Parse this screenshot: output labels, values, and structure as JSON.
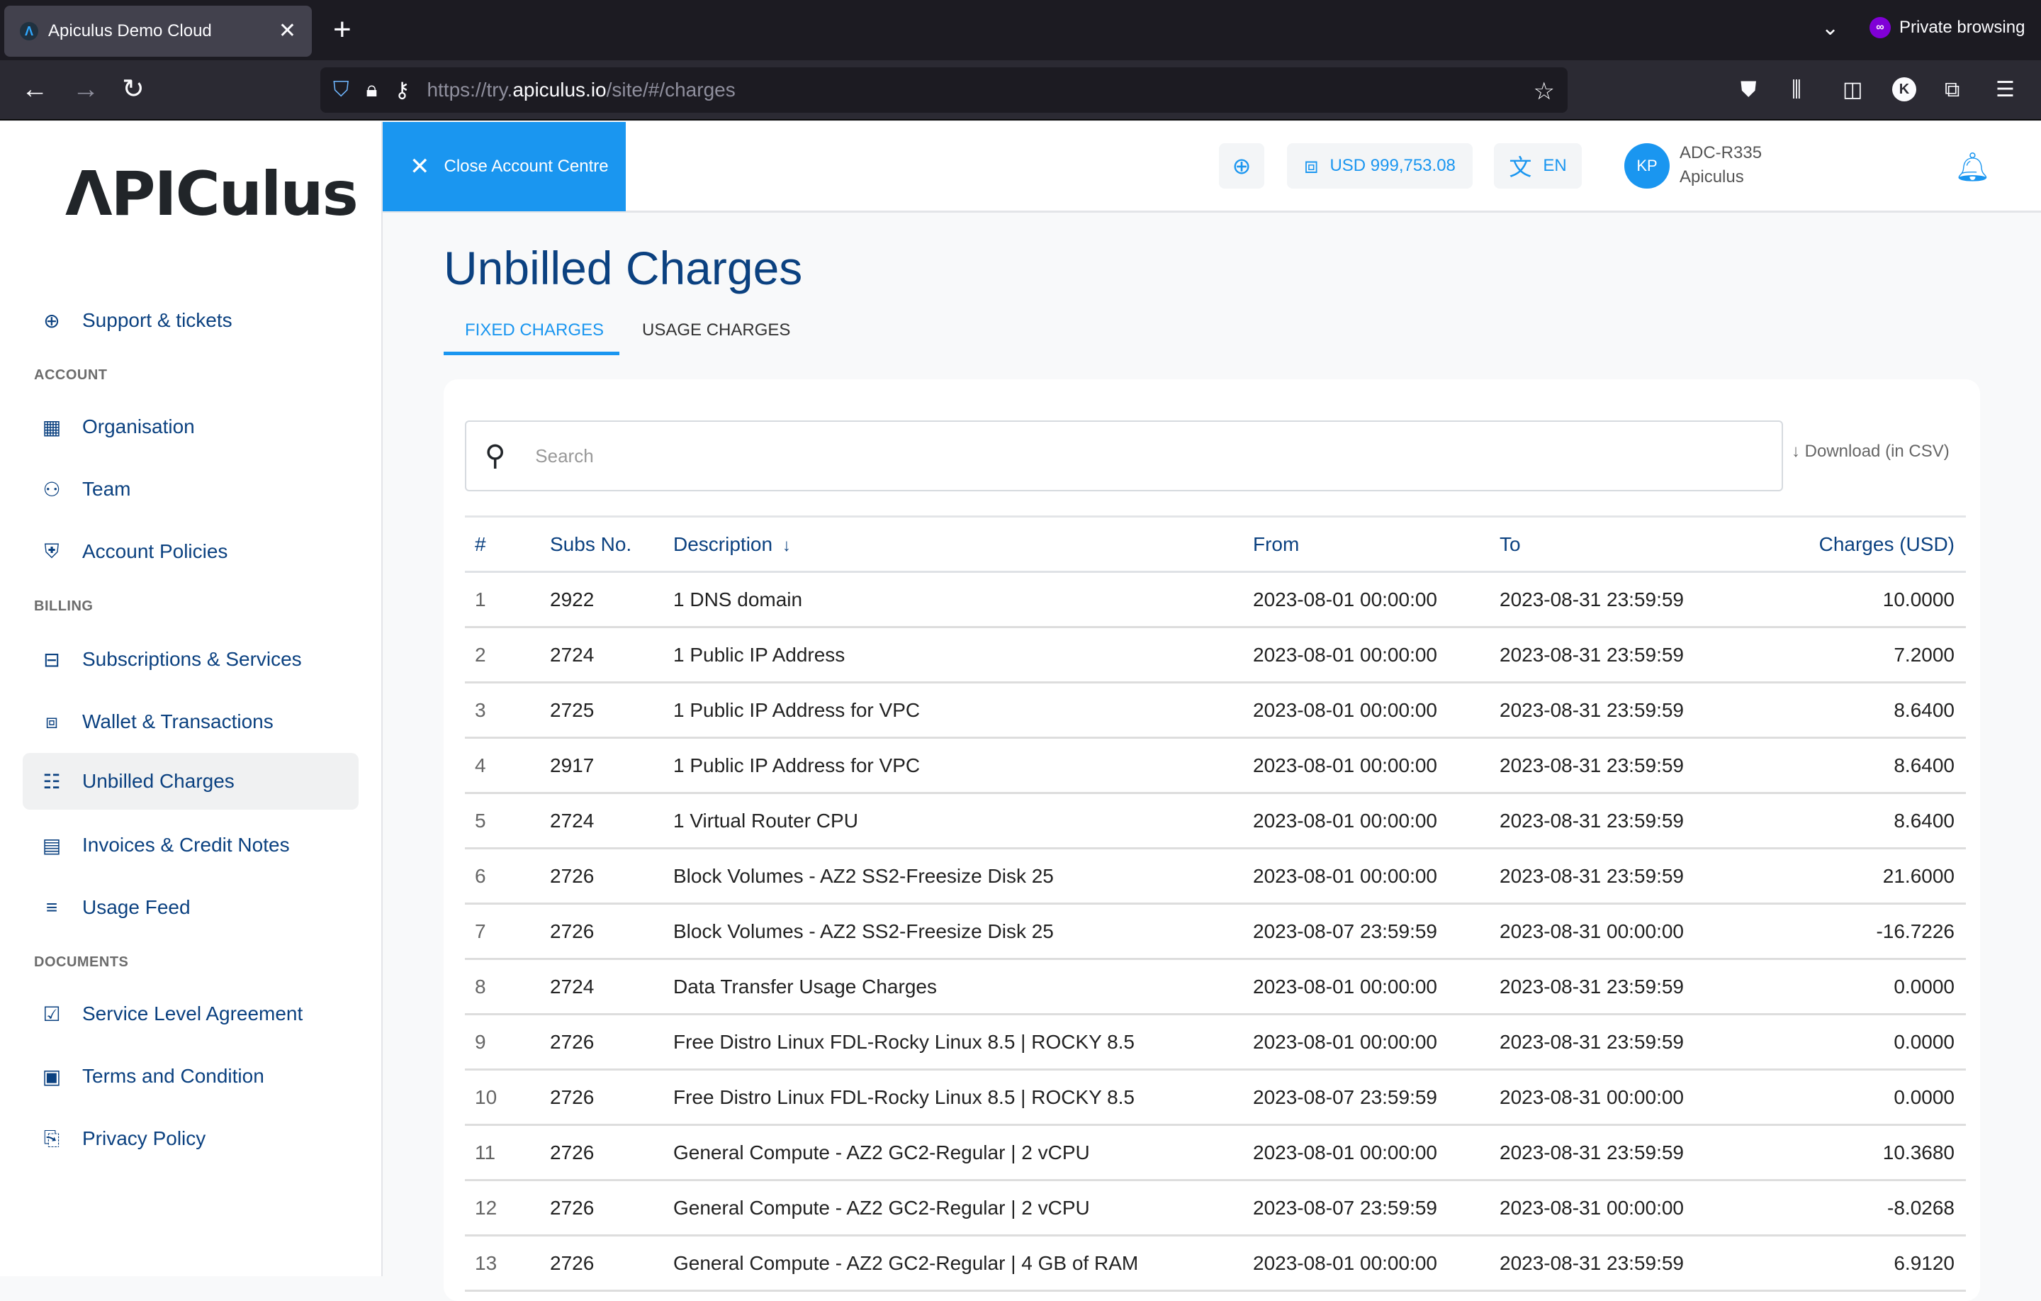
{
  "browser": {
    "tab_title": "Apiculus Demo Cloud",
    "tab_favicon": "Λ",
    "new_tab": "+",
    "private_label": "Private browsing",
    "url_prefix": "https://try.",
    "url_host": "apiculus.io",
    "url_path": "/site/#/charges",
    "profile_initial": "K"
  },
  "sidebar": {
    "logo": "ΛPICulus",
    "support": {
      "label": "Support & tickets",
      "icon": "lifebuoy-icon"
    },
    "sections": [
      {
        "label": "ACCOUNT",
        "items": [
          {
            "label": "Organisation",
            "icon": "building-icon"
          },
          {
            "label": "Team",
            "icon": "team-icon"
          },
          {
            "label": "Account Policies",
            "icon": "shield-star-icon"
          }
        ]
      },
      {
        "label": "BILLING",
        "items": [
          {
            "label": "Subscriptions & Services",
            "icon": "briefcase-icon"
          },
          {
            "label": "Wallet & Transactions",
            "icon": "wallet-icon"
          },
          {
            "label": "Unbilled Charges",
            "icon": "list-icon",
            "active": true
          },
          {
            "label": "Invoices & Credit Notes",
            "icon": "receipt-icon"
          },
          {
            "label": "Usage Feed",
            "icon": "lines-icon"
          }
        ]
      },
      {
        "label": "DOCUMENTS",
        "items": [
          {
            "label": "Service Level Agreement",
            "icon": "checklist-icon"
          },
          {
            "label": "Terms and Condition",
            "icon": "document-icon"
          },
          {
            "label": "Privacy Policy",
            "icon": "certificate-icon"
          }
        ]
      }
    ]
  },
  "header": {
    "close_label": "Close Account Centre",
    "wallet_balance": "USD 999,753.08",
    "language": "EN",
    "avatar_initials": "KP",
    "account_id": "ADC-R335",
    "account_org": "Apiculus"
  },
  "main": {
    "title": "Unbilled Charges",
    "tabs": [
      {
        "label": "FIXED CHARGES",
        "active": true
      },
      {
        "label": "USAGE CHARGES",
        "active": false
      }
    ],
    "search_placeholder": "Search",
    "search_value": "",
    "download_label": "Download (in CSV)",
    "table": {
      "columns": [
        "#",
        "Subs No.",
        "Description",
        "From",
        "To",
        "Charges (USD)"
      ],
      "sort_column": "Description",
      "sort_direction": "desc",
      "rows": [
        {
          "idx": "1",
          "sub": "2922",
          "desc": "1 DNS domain",
          "from": "2023-08-01 00:00:00",
          "to": "2023-08-31 23:59:59",
          "charge": "10.0000"
        },
        {
          "idx": "2",
          "sub": "2724",
          "desc": "1 Public IP Address",
          "from": "2023-08-01 00:00:00",
          "to": "2023-08-31 23:59:59",
          "charge": "7.2000"
        },
        {
          "idx": "3",
          "sub": "2725",
          "desc": "1 Public IP Address for VPC",
          "from": "2023-08-01 00:00:00",
          "to": "2023-08-31 23:59:59",
          "charge": "8.6400"
        },
        {
          "idx": "4",
          "sub": "2917",
          "desc": "1 Public IP Address for VPC",
          "from": "2023-08-01 00:00:00",
          "to": "2023-08-31 23:59:59",
          "charge": "8.6400"
        },
        {
          "idx": "5",
          "sub": "2724",
          "desc": "1 Virtual Router CPU",
          "from": "2023-08-01 00:00:00",
          "to": "2023-08-31 23:59:59",
          "charge": "8.6400"
        },
        {
          "idx": "6",
          "sub": "2726",
          "desc": "Block Volumes - AZ2 SS2-Freesize Disk 25",
          "from": "2023-08-01 00:00:00",
          "to": "2023-08-31 23:59:59",
          "charge": "21.6000"
        },
        {
          "idx": "7",
          "sub": "2726",
          "desc": "Block Volumes - AZ2 SS2-Freesize Disk 25",
          "from": "2023-08-07 23:59:59",
          "to": "2023-08-31 00:00:00",
          "charge": "-16.7226"
        },
        {
          "idx": "8",
          "sub": "2724",
          "desc": "Data Transfer Usage Charges",
          "from": "2023-08-01 00:00:00",
          "to": "2023-08-31 23:59:59",
          "charge": "0.0000"
        },
        {
          "idx": "9",
          "sub": "2726",
          "desc": "Free Distro Linux FDL-Rocky Linux 8.5 | ROCKY 8.5",
          "from": "2023-08-01 00:00:00",
          "to": "2023-08-31 23:59:59",
          "charge": "0.0000"
        },
        {
          "idx": "10",
          "sub": "2726",
          "desc": "Free Distro Linux FDL-Rocky Linux 8.5 | ROCKY 8.5",
          "from": "2023-08-07 23:59:59",
          "to": "2023-08-31 00:00:00",
          "charge": "0.0000"
        },
        {
          "idx": "11",
          "sub": "2726",
          "desc": "General Compute - AZ2 GC2-Regular | 2 vCPU",
          "from": "2023-08-01 00:00:00",
          "to": "2023-08-31 23:59:59",
          "charge": "10.3680"
        },
        {
          "idx": "12",
          "sub": "2726",
          "desc": "General Compute - AZ2 GC2-Regular | 2 vCPU",
          "from": "2023-08-07 23:59:59",
          "to": "2023-08-31 00:00:00",
          "charge": "-8.0268"
        },
        {
          "idx": "13",
          "sub": "2726",
          "desc": "General Compute - AZ2 GC2-Regular | 4 GB of RAM",
          "from": "2023-08-01 00:00:00",
          "to": "2023-08-31 23:59:59",
          "charge": "6.9120"
        }
      ]
    }
  },
  "colors": {
    "brand_blue": "#1a96f0",
    "nav_text": "#0b4180",
    "active_bg": "#f0f1f2"
  }
}
